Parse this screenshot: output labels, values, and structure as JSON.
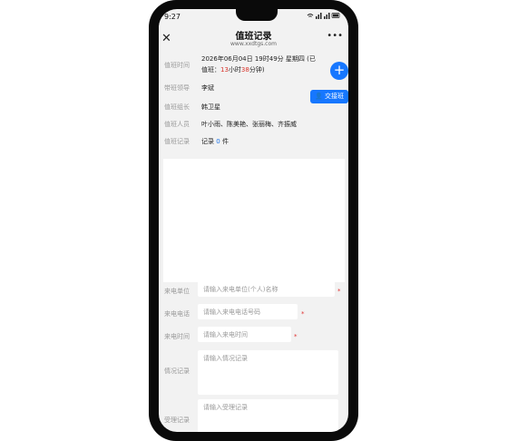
{
  "status": {
    "time": "9:27",
    "icons": "WiFi 4G 4G"
  },
  "nav": {
    "title": "值班记录",
    "subtitle": "www.xxdtgs.com"
  },
  "fields": {
    "duty_time_label": "值班时间",
    "duty_time_date": "2026年06月04日 19时49分 星期四 (已",
    "duty_time_prefix": "值班：",
    "duty_hours": "13",
    "duty_hours_unit": "小时",
    "duty_minutes": "38",
    "duty_minutes_unit": "分钟)",
    "leader_label": "带班领导",
    "leader_value": "李斌",
    "group_leader_label": "值班组长",
    "group_leader_value": "韩卫星",
    "staff_label": "值班人员",
    "staff_value": "叶小雨、陈美艳、张丽梅、齐振威",
    "records_label": "值班记录",
    "records_prefix": "记录",
    "records_count": "0",
    "records_suffix": "件"
  },
  "buttons": {
    "handover": "交接班",
    "add": "+"
  },
  "form": {
    "caller_unit_label": "来电单位",
    "caller_unit_placeholder": "请输入来电单位(个人)名称",
    "caller_phone_label": "来电电话",
    "caller_phone_placeholder": "请输入来电电话号码",
    "call_time_label": "来电时间",
    "call_time_placeholder": "请输入来电时间",
    "situation_label": "情况记录",
    "situation_placeholder": "请输入情况记录",
    "handling_label": "受理记录",
    "handling_placeholder": "请输入受理记录",
    "required_mark": "*"
  }
}
